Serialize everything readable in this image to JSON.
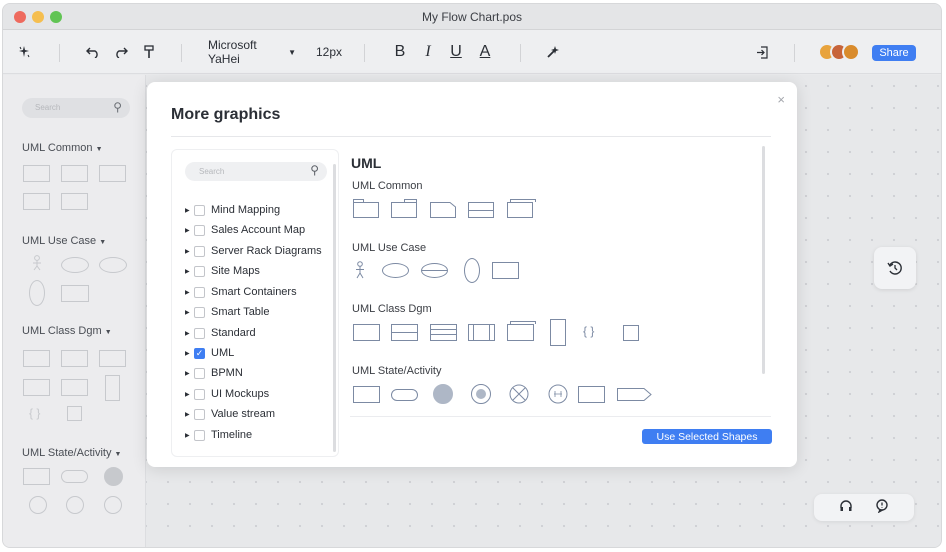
{
  "window": {
    "title": "My Flow Chart.pos"
  },
  "toolbar": {
    "font_family": "Microsoft YaHei",
    "font_size": "12px",
    "bold": "B",
    "italic": "I",
    "underline": "U",
    "font_color": "A",
    "share_label": "Share"
  },
  "sidebar": {
    "search_placeholder": "Search",
    "sections": [
      "UML Common",
      "UML Use Case",
      "UML Class Dgm",
      "UML State/Activity"
    ]
  },
  "modal": {
    "title": "More graphics",
    "close_glyph": "×",
    "search_placeholder": "Search",
    "categories": [
      {
        "label": "Mind Mapping",
        "checked": false
      },
      {
        "label": "Sales Account Map",
        "checked": false
      },
      {
        "label": "Server Rack Diagrams",
        "checked": false
      },
      {
        "label": "Site Maps",
        "checked": false
      },
      {
        "label": "Smart Containers",
        "checked": false
      },
      {
        "label": "Smart Table",
        "checked": false
      },
      {
        "label": "Standard",
        "checked": false
      },
      {
        "label": "UML",
        "checked": true
      },
      {
        "label": "BPMN",
        "checked": false
      },
      {
        "label": "UI Mockups",
        "checked": false
      },
      {
        "label": "Value stream",
        "checked": false
      },
      {
        "label": "Timeline",
        "checked": false
      }
    ],
    "heading": "UML",
    "sections": [
      "UML Common",
      "UML Use Case",
      "UML Class Dgm",
      "UML State/Activity"
    ],
    "use_button": "Use Selected Shapes"
  },
  "colors": {
    "accent": "#3f7ef2",
    "shape_stroke": "#7c8aa3",
    "shape_fill_gray": "#aeb7c6"
  },
  "icons": {
    "toolbar_left": [
      "sparkle-icon",
      "undo-icon",
      "redo-icon",
      "format-painter-icon"
    ],
    "toolbar_right": [
      "magic-wand-icon",
      "export-icon"
    ],
    "floating": [
      "history-icon",
      "headset-icon",
      "feedback-icon"
    ]
  }
}
